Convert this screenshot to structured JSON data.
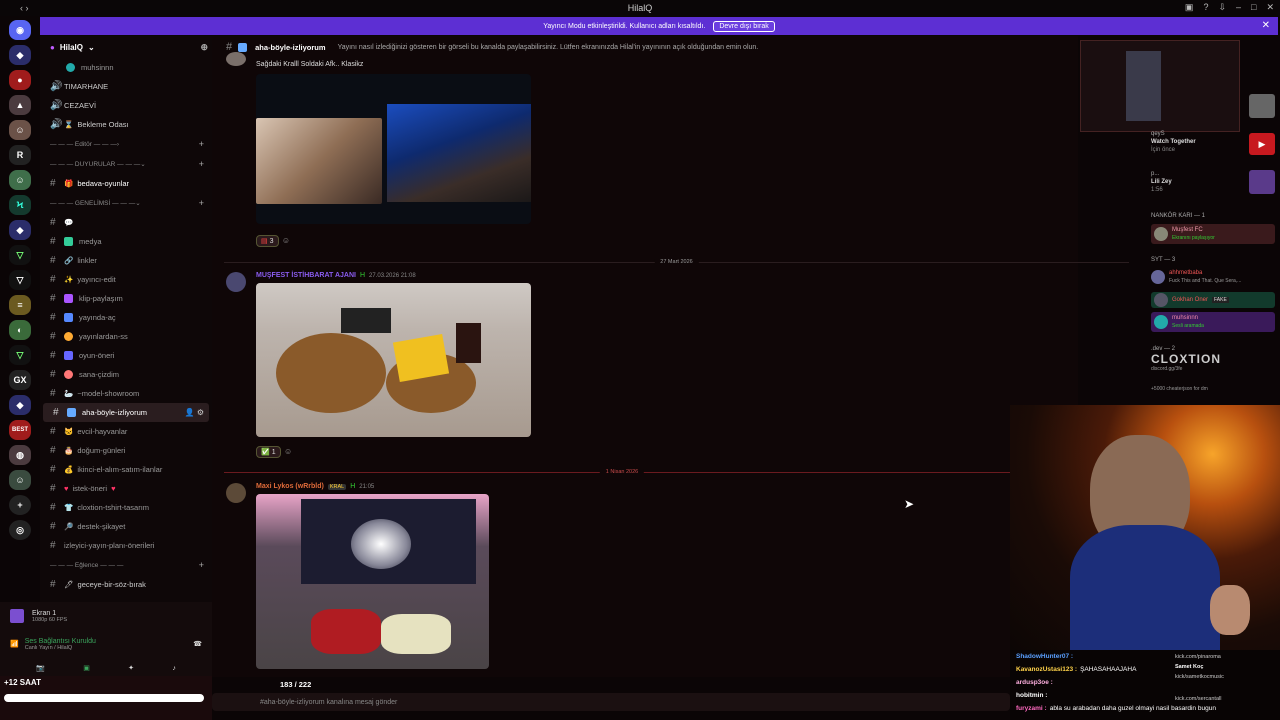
{
  "window": {
    "title": "HilalQ"
  },
  "banner": {
    "text": "Yayıncı Modu etkinleştirildi. Kullanıcı adları kısaltıldı.",
    "button": "Devre dışı bırak"
  },
  "server": {
    "name": "HilalQ",
    "voice_user": "muhsinnn"
  },
  "channels": {
    "timarhane": "TIMARHANE",
    "cezaevi": "CEZAEVİ",
    "bekleme": "Bekleme Odası",
    "cat_editor": "— — — Editör — — —",
    "cat_duyurular": "— — — DUYURULAR — — —",
    "bedava": "bedava-oyunlar",
    "cat_genel": "— — — GENELİMSİ — — —",
    "medya": "medya",
    "linkler": "linkler",
    "yayinci_edit": "yayıncı-edit",
    "klip": "klip-paylaşım",
    "yayinda": "yayında-aç",
    "yayinlardan": "yayınlardan-ss",
    "oyun": "oyun-öneri",
    "sana": "sana-çizdim",
    "model": "~model-showroom",
    "aha": "aha-böyle-izliyorum",
    "evcil": "evcil-hayvanlar",
    "dogum": "doğum-günleri",
    "ikinci": "ikinci-el-alım-satım-ilanlar",
    "istek": "istek-öneri",
    "cloxtion": "cloxtion-tshirt-tasarım",
    "destek": "destek-şikayet",
    "izleyici": "izleyici-yayın-planı-önerileri",
    "cat_eglence": "— — — Eğlence — — —",
    "geceye": "geceye-bir-söz-bırak"
  },
  "userarea": {
    "screen": "Ekran 1",
    "screen_sub": "1080p 60 FPS",
    "voice": "Ses Bağlantısı Kuruldu",
    "voice_sub": "Canlı Yayın / HilalQ"
  },
  "header": {
    "channel": "aha-böyle-izliyorum",
    "topic": "Yayını nasıl izlediğinizi gösteren bir görseli bu kanalda paylaşabilirsiniz. Lütfen ekranınızda Hilal'in yayınının açık olduğundan emin olun."
  },
  "messages": {
    "m0_text": "Sağdaki Kralll Soldaki Afk.. Klasikz",
    "m0_react": "3",
    "date1": "27 Mart 2026",
    "m1_user": "MUŞFEST İSTİHBARAT AJANI",
    "m1_time": "27.03.2026 21:08",
    "m1_react": "1",
    "date2": "1 Nisan 2026",
    "m2_user": "Maxi Lykos (wRrbld)",
    "m2_tag": "KRAL",
    "m2_time": "21:05"
  },
  "input": {
    "placeholder": "#aha-böyle-izliyorum kanalına mesaj gönder",
    "counter": "183 / 222",
    "timer": "+12 SAAT"
  },
  "members": {
    "act1_user": "qeyS",
    "act1_title": "Watch Together",
    "act1_sub": "İçin önce",
    "act2_user": "p...",
    "act2_title": "Lili Zey",
    "act2_sub": "1:56",
    "group1": "NANKÖR KARI — 1",
    "m1": "Muşfest FC",
    "m1_sub": "Ekranını paylaşıyor",
    "group2": "SYT — 3",
    "m2": "ahhmetbaba",
    "m2_sub": "Fuck This and That. Que Sera,...",
    "m3": "Gokhan Oner",
    "m3_badge": "FAKE",
    "m4": "muhsinnn",
    "m4_sub": "Sesli aramada",
    "group3": ".dev — 2",
    "m5": "CLOXTION",
    "m5_sub": "discord.gg/3fe",
    "m6_sub": "+5000 cheaterjson for dm"
  },
  "chat": [
    {
      "user": "ShadowHunter07 :",
      "text": "",
      "color": "#5aa0ff"
    },
    {
      "user": "KavanozUstasi123 :",
      "text": "ŞAHASAHAAJAHA",
      "color": "#ffd34a"
    },
    {
      "user": "ardusp3oe :",
      "text": "",
      "color": "#ffb0e0"
    },
    {
      "user": "hobitmin :",
      "text": "",
      "color": "#ffffff"
    },
    {
      "user": "furyzami :",
      "text": "abla su arabadan daha guzel olmayi nasil basardin bugun",
      "color": "#ff6ac1"
    }
  ],
  "chat_right": [
    {
      "t": "kick.com/pinaroma"
    },
    {
      "t": "Samet Koç"
    },
    {
      "t": "kick/sametkocmusic"
    },
    {
      "t": "kick.com/sercantall"
    }
  ]
}
